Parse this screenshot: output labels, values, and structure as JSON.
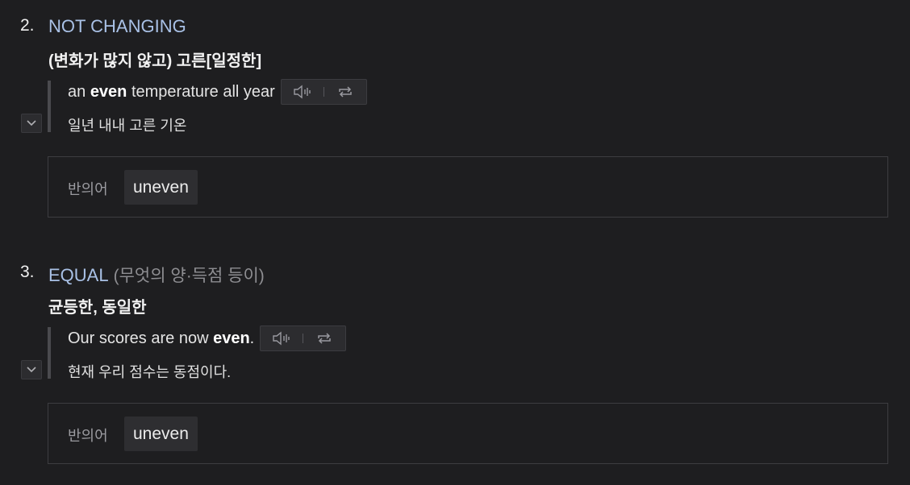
{
  "senses": [
    {
      "number": "2.",
      "keyword": "NOT CHANGING",
      "note": "",
      "definition_ko": "(변화가 많지 않고) 고른[일정한]",
      "example": {
        "before": "an ",
        "bold": "even",
        "after": " temperature all year",
        "translation": "일년 내내 고른 기온"
      },
      "related": {
        "label": "반의어",
        "word": "uneven"
      }
    },
    {
      "number": "3.",
      "keyword": "EQUAL",
      "note": "(무엇의 양·득점 등이)",
      "definition_ko": "균등한, 동일한",
      "example": {
        "before": "Our scores are now ",
        "bold": "even",
        "after": ".",
        "translation": "현재 우리 점수는 동점이다."
      },
      "related": {
        "label": "반의어",
        "word": "uneven"
      }
    }
  ],
  "icons": {
    "audio": "speaker-icon",
    "repeat": "repeat-icon",
    "toggle": "chevron-down-icon"
  },
  "colors": {
    "background": "#1e1e20",
    "keyword": "#a9c1e6",
    "muted": "#8e8e92"
  }
}
